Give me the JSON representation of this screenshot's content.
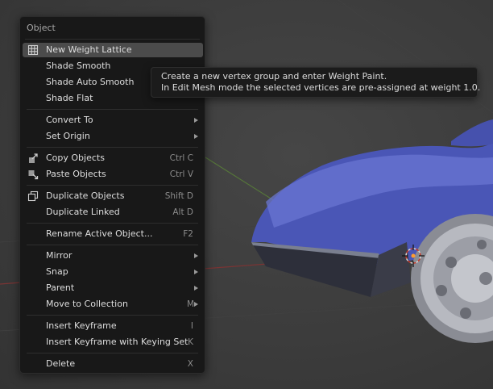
{
  "menu": {
    "title": "Object",
    "items": [
      {
        "label": "New Weight Lattice",
        "shortcut": "",
        "icon": "lattice-icon",
        "highlighted": true
      },
      {
        "label": "Shade Smooth",
        "shortcut": ""
      },
      {
        "label": "Shade Auto Smooth",
        "shortcut": ""
      },
      {
        "label": "Shade Flat",
        "shortcut": ""
      },
      {
        "label": "Convert To",
        "shortcut": "",
        "submenu": true
      },
      {
        "label": "Set Origin",
        "shortcut": "",
        "submenu": true
      },
      {
        "label": "Copy Objects",
        "shortcut": "Ctrl C",
        "icon": "copy-icon"
      },
      {
        "label": "Paste Objects",
        "shortcut": "Ctrl V",
        "icon": "paste-icon"
      },
      {
        "label": "Duplicate Objects",
        "shortcut": "Shift D",
        "icon": "duplicate-icon"
      },
      {
        "label": "Duplicate Linked",
        "shortcut": "Alt D"
      },
      {
        "label": "Rename Active Object...",
        "shortcut": "F2"
      },
      {
        "label": "Mirror",
        "shortcut": "",
        "submenu": true
      },
      {
        "label": "Snap",
        "shortcut": "",
        "submenu": true
      },
      {
        "label": "Parent",
        "shortcut": "",
        "submenu": true
      },
      {
        "label": "Move to Collection",
        "shortcut": "M",
        "submenu": true
      },
      {
        "label": "Insert Keyframe",
        "shortcut": "I"
      },
      {
        "label": "Insert Keyframe with Keying Set",
        "shortcut": "K"
      },
      {
        "label": "Delete",
        "shortcut": "X"
      }
    ]
  },
  "tooltip": {
    "line1": "Create a new vertex group and enter Weight Paint.",
    "line2": "In Edit Mesh mode the selected vertices are pre-assigned at weight 1.0."
  },
  "colors": {
    "menu_bg": "#181818",
    "highlight": "#4b4b4b",
    "car_body": "#4a57b8",
    "grid_red": "#8a3a3a",
    "grid_green": "#5a7a3a"
  }
}
